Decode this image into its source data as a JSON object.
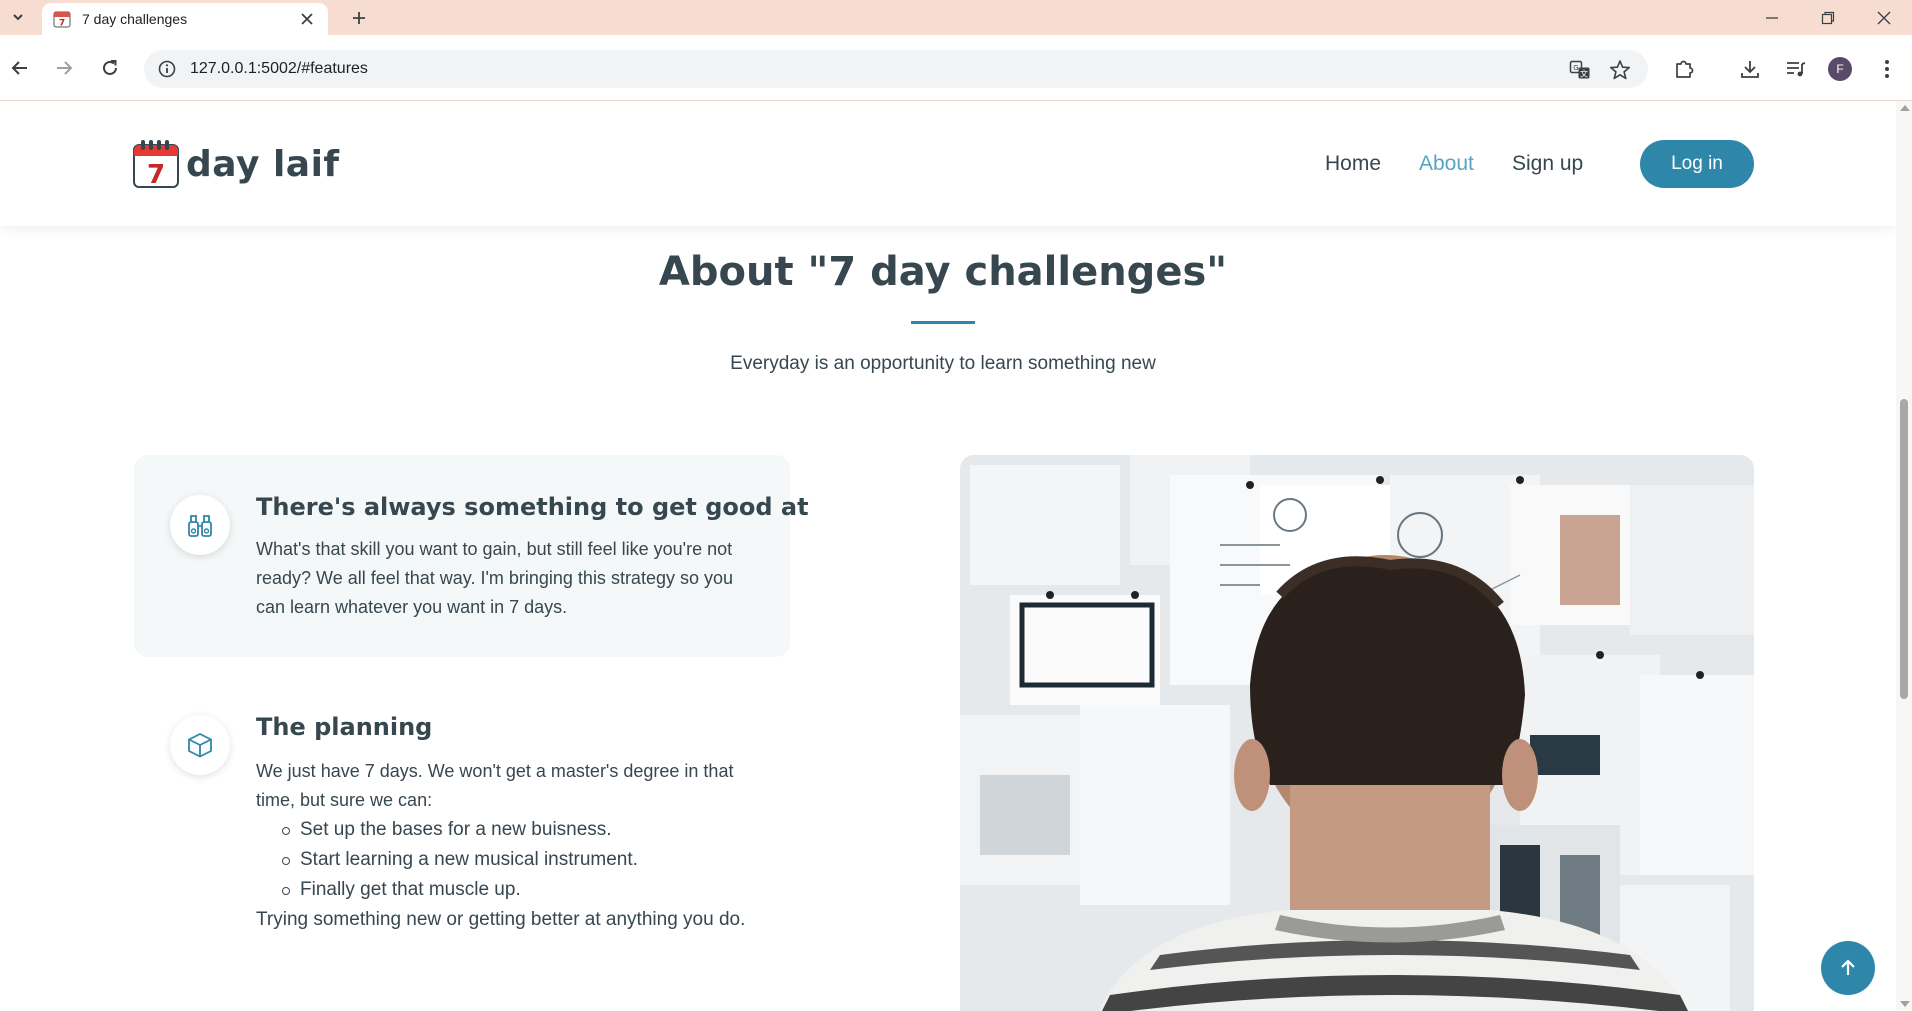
{
  "browser": {
    "tab_title": "7 day challenges",
    "url": "127.0.0.1:5002/#features",
    "profile_initial": "F",
    "icons": [
      "tab-search-icon",
      "calendar-favicon",
      "close-icon",
      "plus-icon",
      "minimize-icon",
      "restore-icon",
      "window-close-icon",
      "back-arrow-icon",
      "forward-arrow-icon",
      "reload-icon",
      "site-info-icon",
      "translate-icon",
      "star-icon",
      "extensions-icon",
      "download-icon",
      "media-icon",
      "kebab-menu-icon"
    ]
  },
  "site": {
    "logo_text": "day laif",
    "logo_digit": "7",
    "nav": {
      "home": "Home",
      "about": "About",
      "signup": "Sign up",
      "login": "Log in"
    },
    "accent_color": "#2e87a8",
    "active_link_color": "#5aa3c3"
  },
  "about": {
    "title": "About \"7 day challenges\"",
    "subtitle": "Everyday is an opportunity to learn something new",
    "features": [
      {
        "icon": "binoculars-icon",
        "title": "There's always something to get good at",
        "text": "What's that skill you want to gain, but still feel like you're not ready? We all feel that way. I'm bringing this strategy so you can learn whatever you want in 7 days."
      },
      {
        "icon": "box-icon",
        "title": "The planning",
        "text": "We just have 7 days. We won't get a master's degree in that time, but sure we can:",
        "list": [
          "Set up the bases for a new buisness.",
          "Start learning a new musical instrument.",
          "Finally get that muscle up."
        ],
        "footer": "Trying something new or getting better at anything you do."
      }
    ],
    "image_alt": "man-looking-at-wall-of-sketches"
  }
}
